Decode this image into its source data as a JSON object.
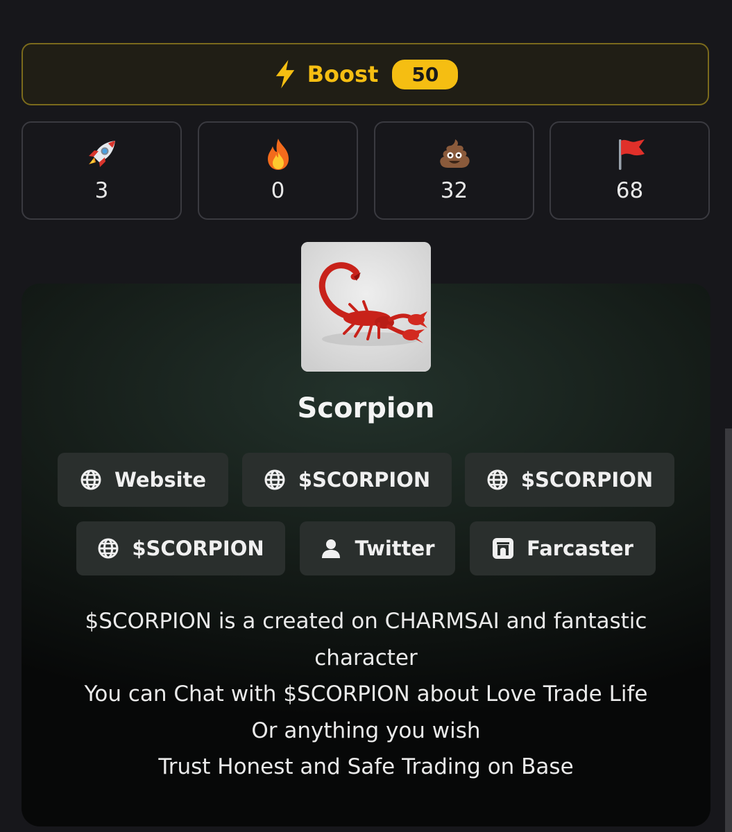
{
  "boost": {
    "label": "Boost",
    "count": "50",
    "icon": "lightning-icon",
    "accent": "#f5be12"
  },
  "reactions": [
    {
      "icon": "rocket-icon",
      "count": "3"
    },
    {
      "icon": "fire-icon",
      "count": "0"
    },
    {
      "icon": "poop-icon",
      "count": "32"
    },
    {
      "icon": "flag-icon",
      "count": "68"
    }
  ],
  "token": {
    "name": "Scorpion",
    "image": "scorpion-avatar"
  },
  "links": [
    {
      "label": "Website",
      "icon": "globe-icon"
    },
    {
      "label": "$SCORPION",
      "icon": "globe-icon"
    },
    {
      "label": "$SCORPION",
      "icon": "globe-icon"
    },
    {
      "label": "$SCORPION",
      "icon": "globe-icon"
    },
    {
      "label": "Twitter",
      "icon": "user-icon"
    },
    {
      "label": "Farcaster",
      "icon": "farcaster-icon"
    }
  ],
  "description": [
    "$SCORPION is a created on CHARMSAI and fantastic",
    "character",
    "You can Chat with $SCORPION about Love Trade Life",
    "Or anything you wish",
    "Trust Honest and Safe Trading on Base"
  ]
}
